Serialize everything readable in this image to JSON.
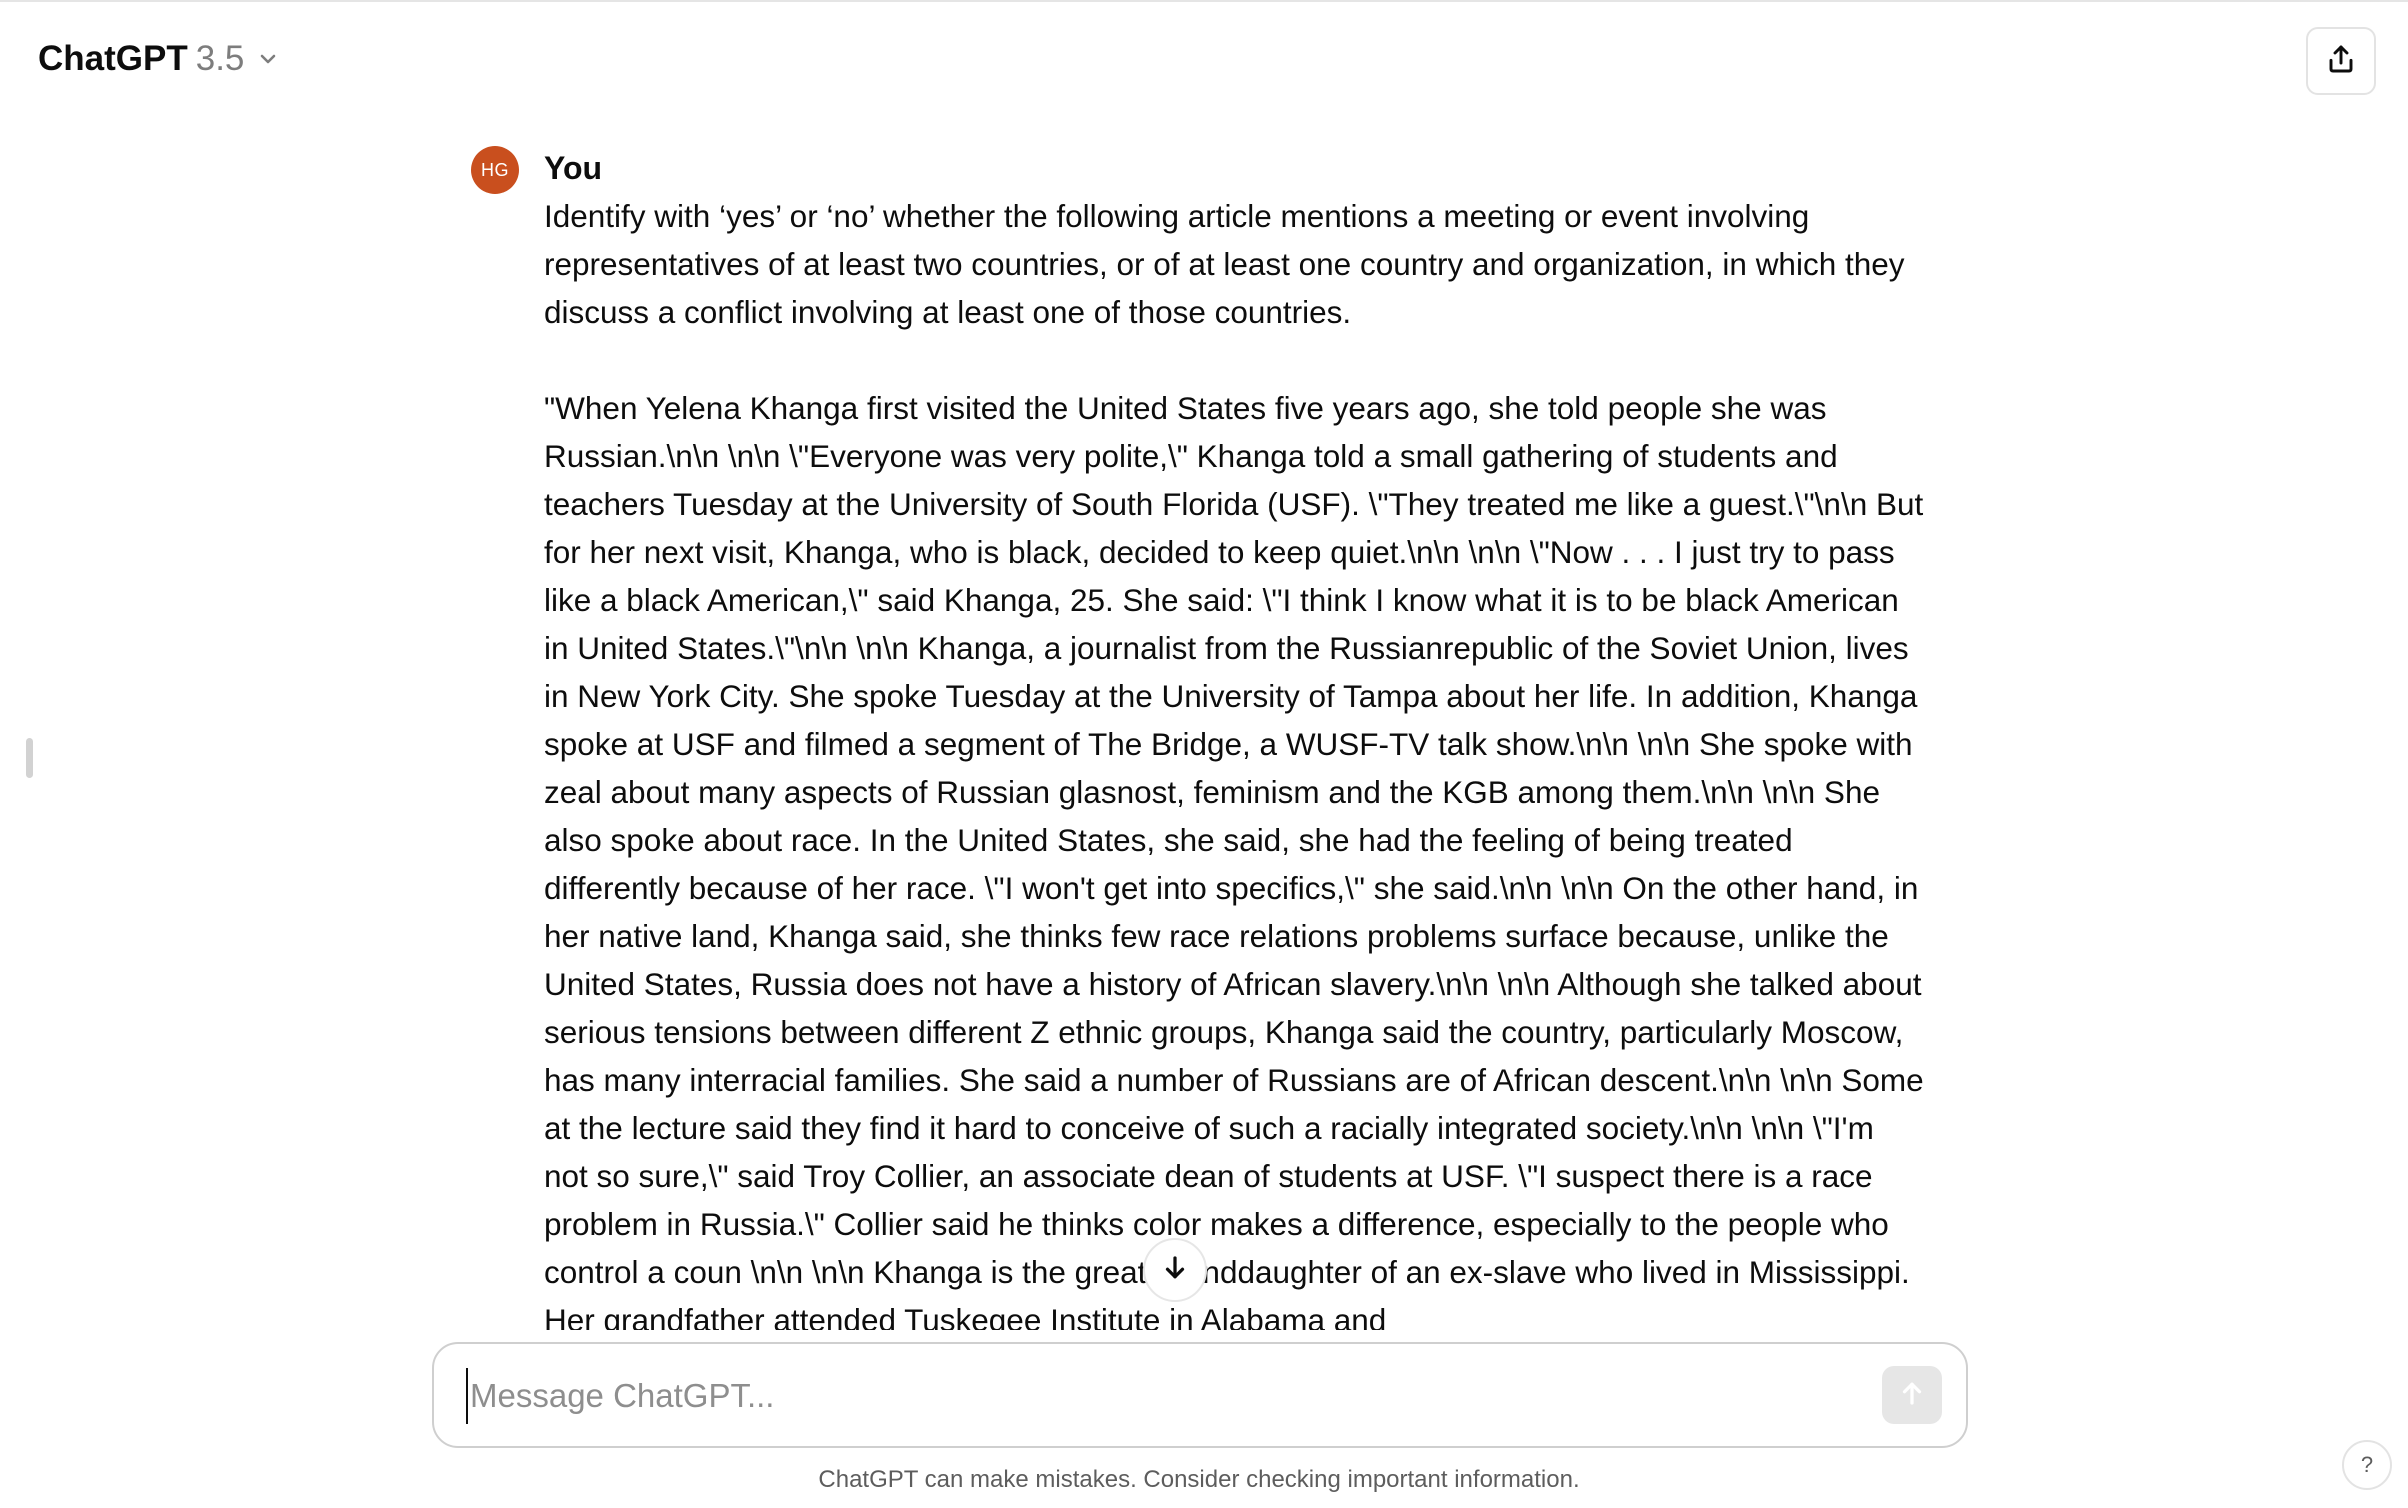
{
  "header": {
    "model_name": "ChatGPT",
    "model_version": "3.5",
    "chevron_icon": "chevron-down-icon",
    "share_icon": "share-icon"
  },
  "conversation": {
    "message": {
      "avatar_initials": "HG",
      "avatar_color": "#c94f1e",
      "author": "You",
      "question": "Identify with ‘yes’ or ‘no’ whether the following article mentions a meeting or event involving representatives of at least two countries, or of at least one country and organization, in which they discuss a conflict involving at least one of those countries.",
      "article": "\"When Yelena Khanga first visited the United States five years ago, she told people she was Russian.\\n\\n \\n\\n    \\\"Everyone was very polite,\\\" Khanga told a small gathering of students and teachers Tuesday at the University of South Florida (USF). \\\"They treated me like a guest.\\\"\\n\\n But for her next visit, Khanga, who is black, decided to keep quiet.\\n\\n \\n\\n    \\\"Now . . . I just try to pass like a black American,\\\" said Khanga, 25.  She said: \\\"I think I know what it is to be black American in United States.\\\"\\n\\n \\n\\n    Khanga, a journalist from the Russianrepublic of the Soviet Union, lives in New York City. She spoke Tuesday at the University of Tampa about her life. In addition, Khanga spoke at USF and filmed a segment of The Bridge, a WUSF-TV talk show.\\n\\n \\n\\n    She spoke with zeal about many aspects of Russian glasnost, feminism and the KGB among them.\\n\\n \\n\\n    She also spoke about race. In the United States, she said, she had the feeling of being treated differently because of her race. \\\"I won't get into specifics,\\\" she said.\\n\\n \\n\\n    On the other hand, in her native land, Khanga said, she thinks few race relations problems surface because, unlike the United States, Russia does not have a history of African slavery.\\n\\n \\n\\n Although she talked about serious tensions between different Z ethnic groups, Khanga said the country, particularly Moscow, has many interracial families. She said a number of Russians are of African descent.\\n\\n \\n\\n    Some at the lecture said they find it hard to conceive of such a racially integrated society.\\n\\n \\n\\n    \\\"I'm not so sure,\\\" said Troy Collier, an associate dean of students at USF. \\\"I suspect there is a race problem in Russia.\\\" Collier said he thinks color makes a difference, especially to the people who control a coun \\n\\n \\n\\n    Khanga is the great-granddaughter of an ex-slave who lived in Mississippi. Her grandfather attended Tuskegee Institute in Alabama and"
    }
  },
  "scroll_down_icon": "arrow-down-icon",
  "composer": {
    "placeholder": "Message ChatGPT...",
    "value": "",
    "send_icon": "arrow-up-icon"
  },
  "footer": {
    "disclaimer": "ChatGPT can make mistakes. Consider checking important information.",
    "help_label": "?"
  }
}
